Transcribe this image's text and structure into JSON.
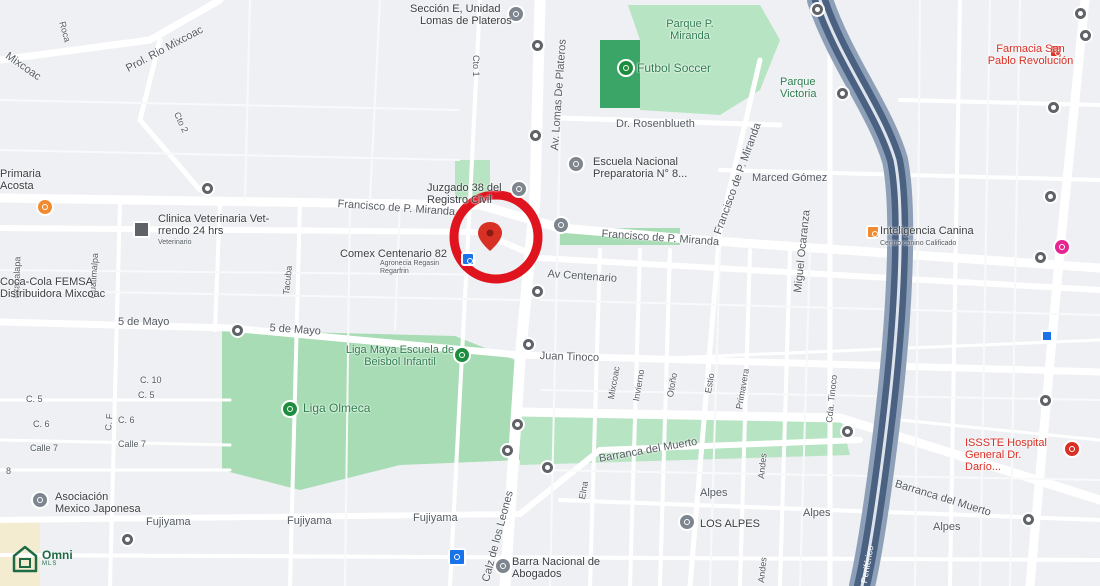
{
  "map": {
    "labels": {
      "seccion": "Sección E, Unidad",
      "lomas_plateros": "Lomas de Plateros",
      "prol_rio": "Prol. Rio Mixcoac",
      "mixcoac": "Mixcoac",
      "roca": "Roca",
      "cto1": "Cto 1",
      "cto2": "Cto 2",
      "av_lomas": "Av. Lomas De Plateros",
      "parque_miranda": "Parque P. Miranda",
      "futbol": "Futbol Soccer",
      "parque_victoria": "Parque Victoria",
      "dr_rosen": "Dr. Rosenblueth",
      "escuela_prep": "Escuela Nacional Preparatoria N° 8...",
      "francisco_diag": "Francisco de P. Miranda",
      "marced": "Marced Gómez",
      "primaria": "Primaria Acosta",
      "juzgado": "Juzgado 38 del Registro Civil",
      "francisco_left": "Francisco de P. Miranda",
      "francisco_right": "Francisco de P. Miranda",
      "clinica": "Clinica Veterinaria Vet-rrendo 24 hrs",
      "clinica_sub": "Veterinario",
      "comex": "Comex Centenario 82",
      "comex_sub": "Agronecia Regasin Regarfrin",
      "av_centenario": "Av Centenario",
      "inteligencia": "Inteligencia Canina",
      "inteligencia_sub": "Centro canino Calificado",
      "farmacia": "Farmacia San Pablo Revolución",
      "miguel": "Miguel Ocaranza",
      "iztapalapa": "Iztapalapa",
      "cuatimalpa": "Cuatimalpa",
      "tacuba": "Tacuba",
      "cocacola": "Coca-Cola FEMSA Distribuidora Mixcoac",
      "cinco_mayo_1": "5 de Mayo",
      "cinco_mayo_2": "5 de Mayo",
      "liga_maya": "Liga Maya Escuela de Beisbol Infantil",
      "juan_tinoco": "Juan Tinoco",
      "c10": "C. 10",
      "c5a": "C. 5",
      "c5b": "C. 5",
      "c6a": "C. 6",
      "c6b": "C. 6",
      "cf": "C. F",
      "calle7a": "Calle 7",
      "calle7b": "Calle 7",
      "ocho": "8",
      "liga_olmeca": "Liga Olmeca",
      "mixcoac_st": "Mixcoac",
      "invierno": "Invierno",
      "otono": "Otoño",
      "estio": "Estio",
      "primavera": "Primavera",
      "cda_tinoco": "Cda. Tinoco",
      "issste": "ISSSTE Hospital General Dr. Darío...",
      "barranca_1": "Barranca del Muerto",
      "barranca_2": "Barranca del Muerto",
      "andes_1": "Andes",
      "andes_2": "Andes",
      "alpes_1": "Alpes",
      "alpes_2": "Alpes",
      "alpes_3": "Alpes",
      "los_alpes": "LOS ALPES",
      "asociacion": "Asociación Mexico Japonesa",
      "fujiyama_1": "Fujiyama",
      "fujiyama_2": "Fujiyama",
      "fujiyama_3": "Fujiyama",
      "calz_leones": "Calz de los Leones",
      "elna": "Elna",
      "barra": "Barra Nacional de Abogados",
      "periferico": "Periférico"
    },
    "colors": {
      "background": "#eef0f3",
      "road": "#ffffff",
      "park": "#a8dcb4",
      "highway": "#8ea0b8",
      "highway_inner": "#4a6182",
      "marker_ring": "#e0141e",
      "pin": "#d93025"
    },
    "icons": {
      "marker": "map-pin-icon",
      "highlight": "highlight-circle-icon",
      "logo": "house-logo-icon"
    }
  },
  "brand": {
    "name": "Omni",
    "sub": "MLS"
  }
}
